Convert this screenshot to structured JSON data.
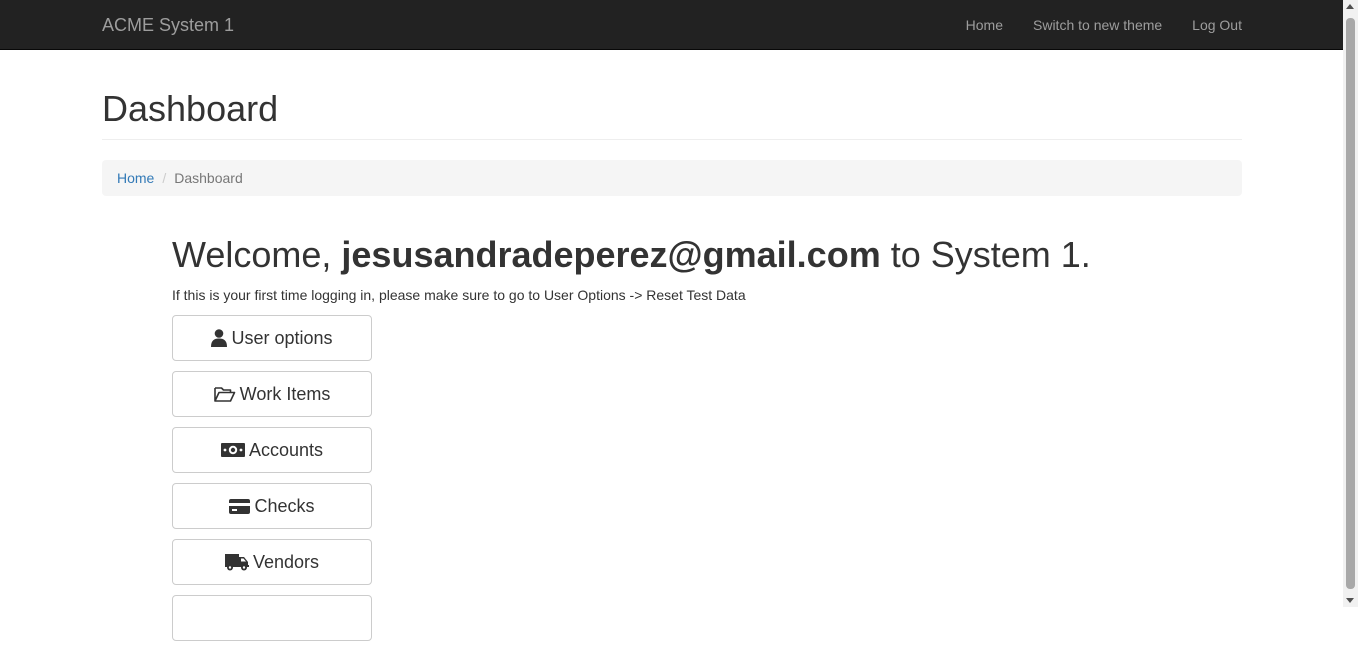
{
  "navbar": {
    "brand": "ACME System 1",
    "links": [
      {
        "label": "Home"
      },
      {
        "label": "Switch to new theme"
      },
      {
        "label": "Log Out"
      }
    ]
  },
  "page": {
    "title": "Dashboard"
  },
  "breadcrumb": {
    "home": "Home",
    "separator": "/",
    "current": "Dashboard"
  },
  "welcome": {
    "prefix": "Welcome,",
    "email": "jesusandradeperez@gmail.com",
    "suffix": "to System 1.",
    "hint": "If this is your first time logging in, please make sure to go to User Options -> Reset Test Data"
  },
  "menu": [
    {
      "label": "User options",
      "icon": "user-icon"
    },
    {
      "label": "Work Items",
      "icon": "folder-open-icon"
    },
    {
      "label": "Accounts",
      "icon": "money-icon"
    },
    {
      "label": "Checks",
      "icon": "credit-card-icon"
    },
    {
      "label": "Vendors",
      "icon": "truck-icon"
    },
    {
      "label": "",
      "icon": ""
    }
  ],
  "colors": {
    "navbar_bg": "#222222",
    "navbar_text": "#9d9d9d",
    "link": "#337ab7",
    "breadcrumb_bg": "#f5f5f5",
    "button_border": "#cccccc"
  }
}
